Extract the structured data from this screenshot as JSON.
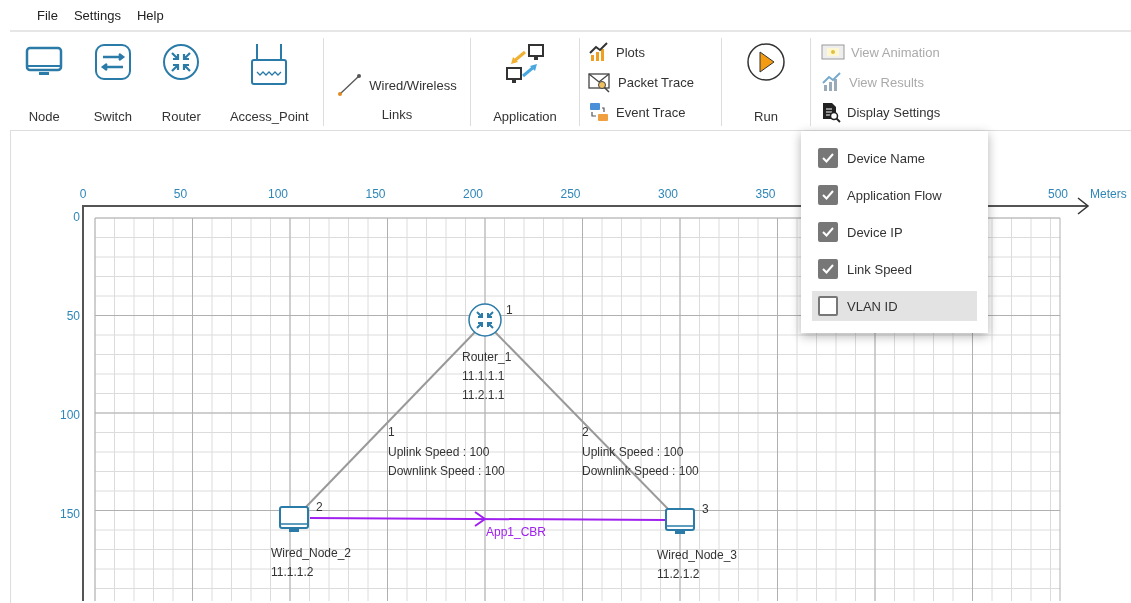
{
  "menu": [
    "File",
    "Settings",
    "Help"
  ],
  "toolbar": {
    "devices": [
      {
        "kind": "node",
        "label": "Node"
      },
      {
        "kind": "switch",
        "label": "Switch"
      },
      {
        "kind": "router",
        "label": "Router"
      },
      {
        "kind": "access_point",
        "label": "Access_Point"
      }
    ],
    "links": {
      "button": "Wired/Wireless",
      "label": "Links"
    },
    "application": "Application",
    "traces": [
      {
        "kind": "plots",
        "label": "Plots"
      },
      {
        "kind": "packet",
        "label": "Packet Trace"
      },
      {
        "kind": "event",
        "label": "Event Trace"
      }
    ],
    "run": "Run",
    "results": [
      {
        "kind": "animation",
        "label": "View Animation",
        "disabled": true
      },
      {
        "kind": "results",
        "label": "View Results",
        "disabled": true
      },
      {
        "kind": "display",
        "label": "Display Settings",
        "disabled": false
      }
    ]
  },
  "display_menu": [
    {
      "label": "Device Name",
      "checked": true,
      "selected": false
    },
    {
      "label": "Application Flow",
      "checked": true,
      "selected": false
    },
    {
      "label": "Device IP",
      "checked": true,
      "selected": false
    },
    {
      "label": "Link Speed",
      "checked": true,
      "selected": false
    },
    {
      "label": "VLAN ID",
      "checked": false,
      "selected": true
    }
  ],
  "canvas": {
    "x_ticks": [
      "0",
      "50",
      "100",
      "150",
      "200",
      "250",
      "300",
      "350",
      "500"
    ],
    "x_unit": "Meters",
    "y_ticks": [
      "0",
      "50",
      "100",
      "150"
    ],
    "devices": [
      {
        "kind": "router",
        "number": "1",
        "name": "Router_1",
        "ips": [
          "11.1.1.1",
          "11.2.1.1"
        ]
      },
      {
        "kind": "node",
        "number": "2",
        "name": "Wired_Node_2",
        "ips": [
          "11.1.1.2"
        ]
      },
      {
        "kind": "node",
        "number": "3",
        "name": "Wired_Node_3",
        "ips": [
          "11.2.1.2"
        ]
      }
    ],
    "links": [
      {
        "number": "1",
        "uplink": "Uplink Speed : 100",
        "downlink": "Downlink Speed : 100"
      },
      {
        "number": "2",
        "uplink": "Uplink Speed : 100",
        "downlink": "Downlink Speed : 100"
      }
    ],
    "flows": [
      {
        "label": "App1_CBR"
      }
    ]
  }
}
